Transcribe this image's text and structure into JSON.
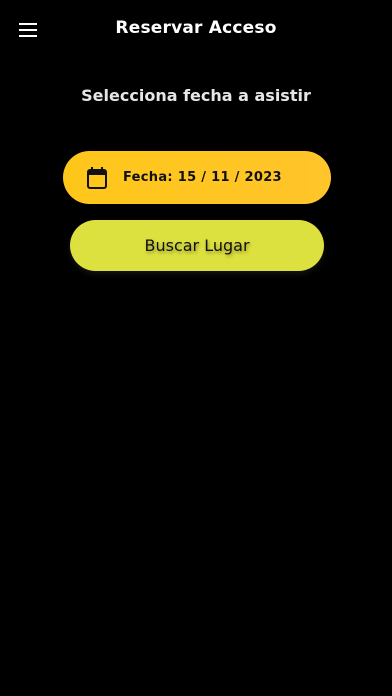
{
  "app_bar": {
    "title": "Reservar Acceso",
    "menu_icon": "hamburger-menu-icon"
  },
  "main": {
    "subtitle": "Selecciona fecha a asistir",
    "date_picker": {
      "icon": "calendar-icon",
      "label": "Fecha: 15 / 11 / 2023"
    },
    "search_button": {
      "label": "Buscar Lugar"
    }
  },
  "colors": {
    "background": "#000000",
    "date_picker_bg": "#ffc61a",
    "search_button_bg": "#dde13f",
    "text_light": "#ffffff",
    "text_dark": "#111111"
  }
}
